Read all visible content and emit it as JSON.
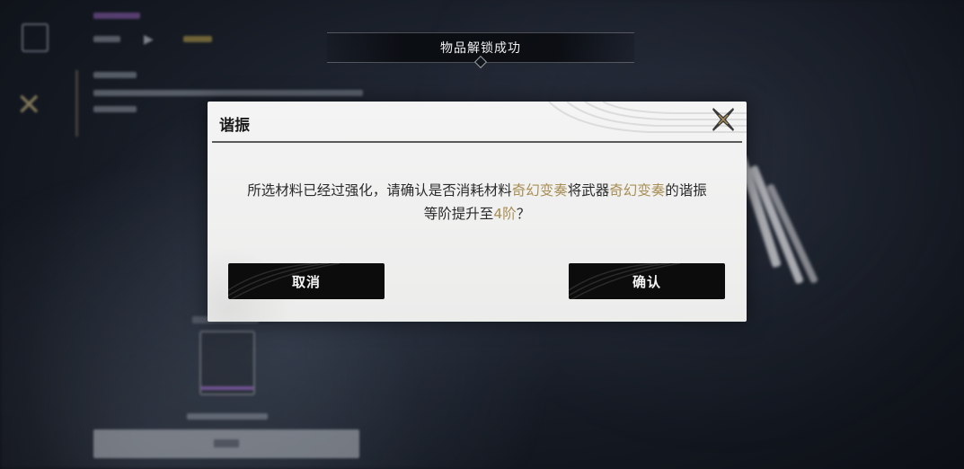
{
  "notice": {
    "text": "物品解锁成功"
  },
  "dialog": {
    "title": "谐振",
    "message": {
      "part1": "所选材料已经过强化，请确认是否消耗材料",
      "material_name": "奇幻变奏",
      "part2": "将武器",
      "weapon_name": "奇幻变奏",
      "part3": "的谐振",
      "part4": "等阶提升至",
      "rank": "4阶",
      "part5": "？"
    },
    "cancel_label": "取消",
    "confirm_label": "确认"
  },
  "colors": {
    "highlight": "#a88e55",
    "button_bg": "#0c0c0c",
    "dialog_bg": "#f4f4f4",
    "rarity_purple": "#a86ad4",
    "level_gold": "#d7bd58"
  },
  "icons": {
    "close": "close-x-icon",
    "left_tab_1": "weapon-icon",
    "left_tab_2": "crossed-swords-icon"
  }
}
